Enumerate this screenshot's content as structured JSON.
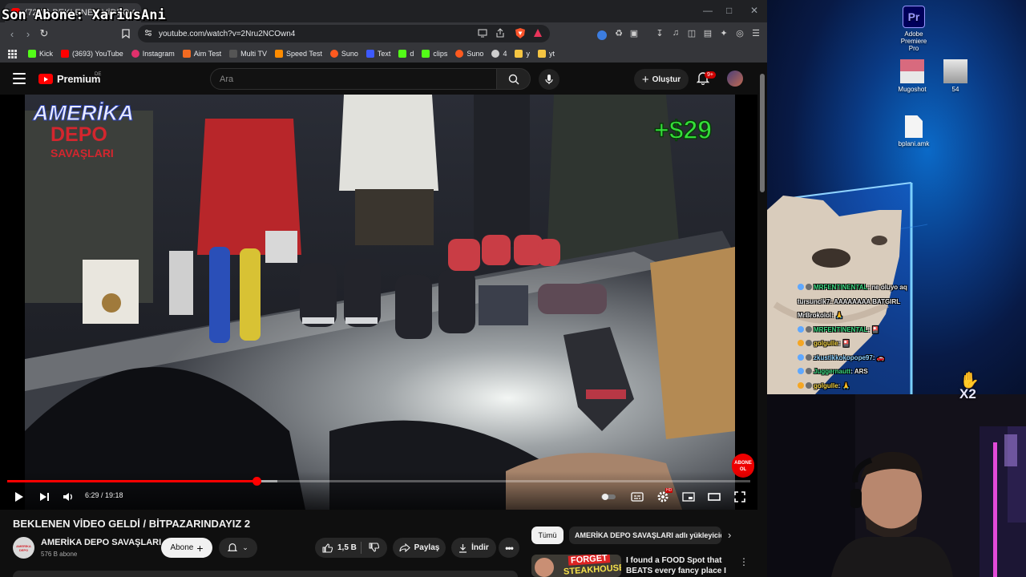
{
  "stream_overlay": {
    "text": "Son Abone: XariusAni"
  },
  "browser": {
    "tab_title": "(7270) BEKLENEN VİDEO GEL",
    "url": "youtube.com/watch?v=2Nru2NCOwn4",
    "extension_badge": "100",
    "bookmarks": [
      {
        "label": "Kick",
        "icon": "kick-icon",
        "color": "#53fc18"
      },
      {
        "label": "(3693) YouTube",
        "icon": "youtube-icon",
        "color": "#ff0000"
      },
      {
        "label": "Instagram",
        "icon": "instagram-icon",
        "color": "#e1306c"
      },
      {
        "label": "Aim Test",
        "icon": "aim-icon",
        "color": "#f26a21"
      },
      {
        "label": "Multi TV",
        "icon": "multitv-icon",
        "color": "#555555"
      },
      {
        "label": "Speed Test",
        "icon": "speedtest-icon",
        "color": "#ff8c00"
      },
      {
        "label": "Suno",
        "icon": "suno-icon",
        "color": "#ff5a1f"
      },
      {
        "label": "Text",
        "icon": "text-icon",
        "color": "#3d5afe"
      },
      {
        "label": "d",
        "icon": "kick-icon",
        "color": "#53fc18"
      },
      {
        "label": "clips",
        "icon": "clips-icon",
        "color": "#53fc18"
      },
      {
        "label": "Suno",
        "icon": "suno-icon",
        "color": "#ff5a1f"
      },
      {
        "label": "4",
        "icon": "circle-icon",
        "color": "#cfcfcf"
      },
      {
        "label": "y",
        "icon": "folder-icon",
        "color": "#f5c542"
      },
      {
        "label": "yt",
        "icon": "folder-icon",
        "color": "#f5c542"
      }
    ]
  },
  "youtube": {
    "logo_text": "Premium",
    "region": "DE",
    "search_placeholder": "Ara",
    "create_label": "Oluştur",
    "notification_count": "9+",
    "video": {
      "overlay_logo_line1": "AMERİKA",
      "overlay_logo_line2": "DEPO",
      "overlay_logo_line3": "SAVAŞLARI",
      "overlay_money": "+$29",
      "abone_badge_line1": "ABONE",
      "abone_badge_line2": "OL",
      "current_time": "6:29",
      "duration": "19:18",
      "time_display": "6:29 / 19:18",
      "progress_fraction": 0.336,
      "buffered_fraction": 0.363
    },
    "title": "BEKLENEN VİDEO GELDİ / BİTPAZARINDAYIZ 2",
    "channel": {
      "name": "AMERİKA DEPO SAVAŞLARI",
      "subscribers": "576 B abone",
      "avatar_text": "AMERİKA DEPO"
    },
    "subscribe_label": "Abone",
    "likes": "1,5 B",
    "share_label": "Paylaş",
    "download_label": "İndir",
    "chips": {
      "all": "Tümü",
      "channel": "AMERİKA DEPO SAVAŞLARI adlı yükleyicid"
    },
    "recommendation": {
      "thumb_line1": "FORGET",
      "thumb_line2": "STEAKHOUSE!",
      "title": "I found a FOOD Spot that BEATS every fancy place I know!"
    }
  },
  "desktop": {
    "icons": [
      {
        "label_line1": "Adobe",
        "label_line2": "Premiere Pro",
        "icon": "premiere-icon",
        "glyph": "Pr"
      },
      {
        "label_line1": "Mugoshot",
        "label_line2": "",
        "icon": "photo-icon",
        "glyph": ""
      },
      {
        "label_line1": "54",
        "label_line2": "",
        "icon": "photo-icon",
        "glyph": ""
      },
      {
        "label_line1": "bplani.amk",
        "label_line2": "",
        "icon": "file-icon",
        "glyph": ""
      }
    ]
  },
  "stream_chat": {
    "messages": [
      {
        "user": "MRFENTINENTAL",
        "text": "ne oluyo aq",
        "user_color": "#3ddc84",
        "badge": "#5fa8ff"
      },
      {
        "user": "tursuncik7",
        "text": "AAAAAAAA BATGIRL",
        "user_color": "#f0f0f0",
        "badge": ""
      },
      {
        "user": "MrBrokolol",
        "text": "🙏",
        "user_color": "#f0f0f0",
        "badge": ""
      },
      {
        "user": "MRFENTINENTAL",
        "text": "🎴",
        "user_color": "#3ddc84",
        "badge": "#5fa8ff"
      },
      {
        "user": "golgulle",
        "text": "🎴",
        "user_color": "#f5d547",
        "badge": "#f5a623"
      },
      {
        "user": "zkustikkokopope97",
        "text": "🚗",
        "user_color": "#8fd3ff",
        "badge": "#5fa8ff"
      },
      {
        "user": "Juggernautt",
        "text": "ARS",
        "user_color": "#3ddc84",
        "badge": "#5fa8ff"
      },
      {
        "user": "golgulle",
        "text": "🙏",
        "user_color": "#f5d547",
        "badge": "#f5a623"
      }
    ],
    "multiplier": "X2"
  }
}
